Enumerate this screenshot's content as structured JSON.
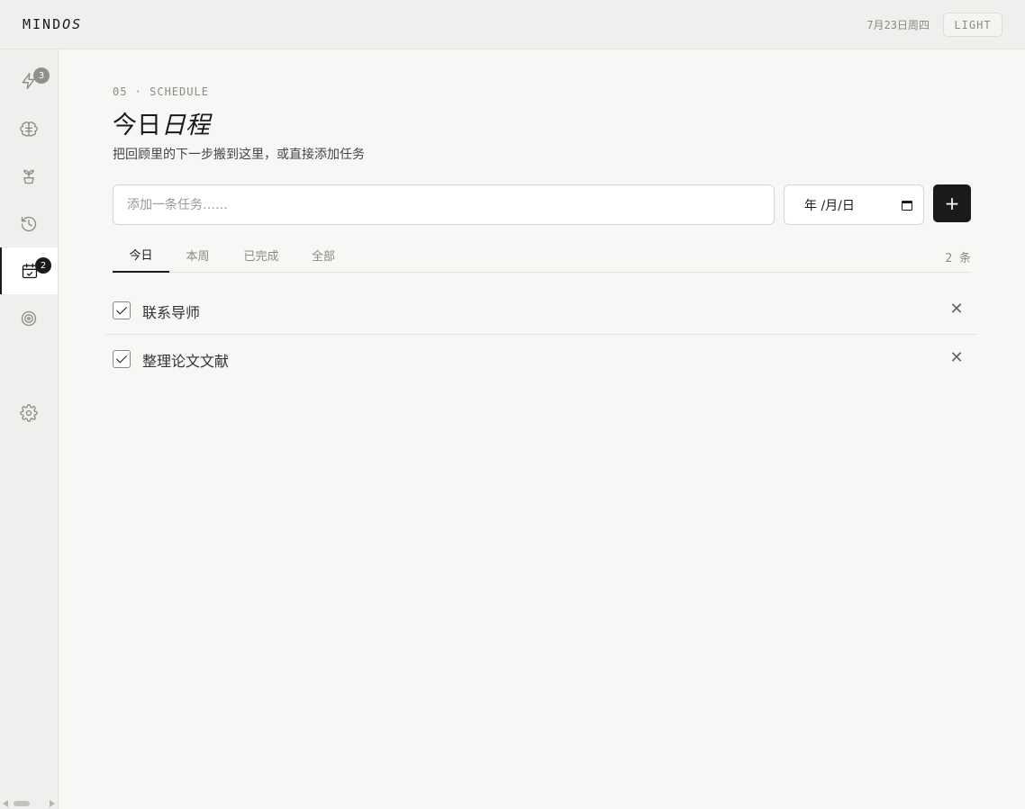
{
  "header": {
    "logo_main": "MIND",
    "logo_accent": "OS",
    "date": "7月23日周四",
    "theme_button": "LIGHT"
  },
  "sidebar": {
    "items": [
      {
        "icon": "lightning-icon",
        "badge": "3"
      },
      {
        "icon": "brain-icon",
        "badge": ""
      },
      {
        "icon": "sprout-icon",
        "badge": ""
      },
      {
        "icon": "history-icon",
        "badge": ""
      },
      {
        "icon": "calendar-check-icon",
        "badge": "2",
        "active": true
      },
      {
        "icon": "target-icon",
        "badge": ""
      },
      {
        "icon": "gear-icon",
        "badge": ""
      }
    ]
  },
  "main": {
    "section_tag": "05 · SCHEDULE",
    "title_plain": "今日",
    "title_italic": "日程",
    "subtitle": "把回顾里的下一步搬到这里，或直接添加任务",
    "input_placeholder": "添加一条任务……",
    "date_placeholder": "年 /月/日",
    "add_button": "+",
    "tabs": [
      {
        "label": "今日",
        "active": true
      },
      {
        "label": "本周"
      },
      {
        "label": "已完成"
      },
      {
        "label": "全部"
      }
    ],
    "count": "2 条",
    "tasks": [
      {
        "text": "联系导师",
        "checked": true
      },
      {
        "text": "整理论文文献",
        "checked": true
      }
    ],
    "delete_glyph": "✕"
  },
  "colors": {
    "background": "#f7f7f5",
    "sidebar": "#efefed",
    "accent": "#1a1a1a",
    "muted": "#8a8a86"
  }
}
